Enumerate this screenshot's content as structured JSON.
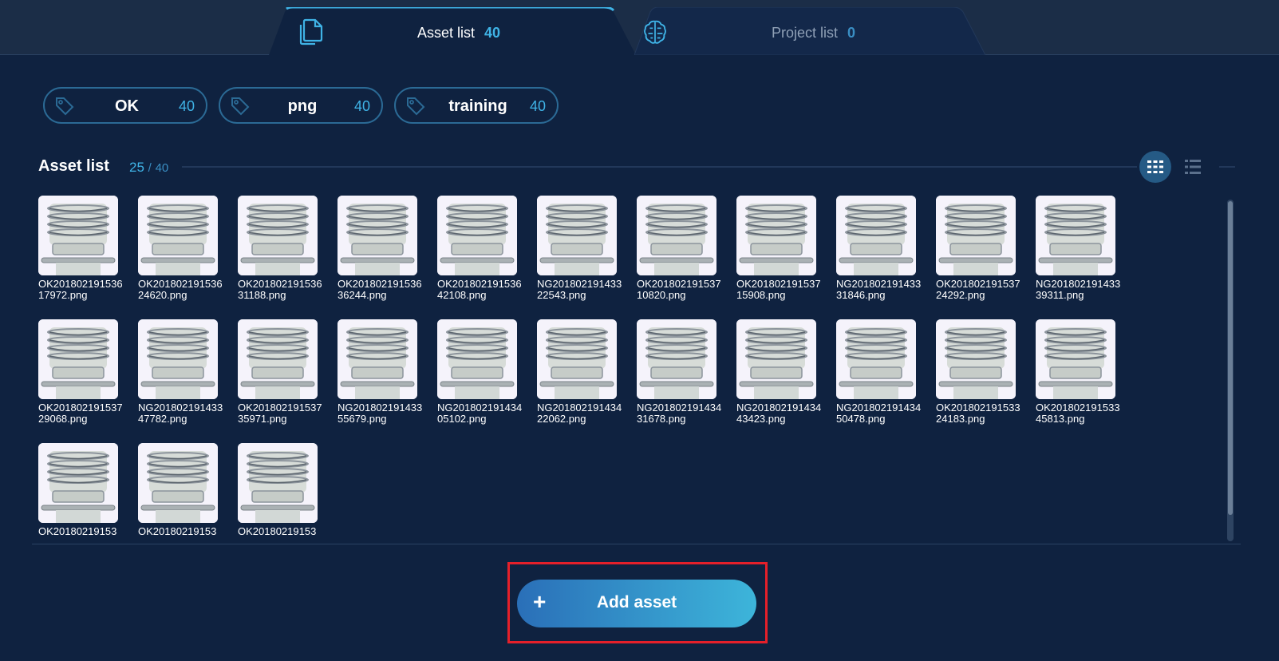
{
  "tabs": [
    {
      "label": "Asset list",
      "count": "40",
      "active": true,
      "icon": "documents-icon"
    },
    {
      "label": "Project list",
      "count": "0",
      "active": false,
      "icon": "brain-icon"
    }
  ],
  "tags": [
    {
      "label": "OK",
      "count": "40"
    },
    {
      "label": "png",
      "count": "40"
    },
    {
      "label": "training",
      "count": "40"
    }
  ],
  "asset_list": {
    "title": "Asset list",
    "shown": "25",
    "separator": "/",
    "total": "40"
  },
  "assets": [
    "OK20180219153617972.png",
    "OK20180219153624620.png",
    "OK20180219153631188.png",
    "OK20180219153636244.png",
    "OK20180219153642108.png",
    "NG20180219143322543.png",
    "OK20180219153710820.png",
    "OK20180219153715908.png",
    "NG20180219143331846.png",
    "OK20180219153724292.png",
    "NG20180219143339311.png",
    "OK20180219153729068.png",
    "NG20180219143347782.png",
    "OK20180219153735971.png",
    "NG20180219143355679.png",
    "NG20180219143405102.png",
    "NG20180219143422062.png",
    "NG20180219143431678.png",
    "NG20180219143443423.png",
    "NG20180219143450478.png",
    "OK20180219153324183.png",
    "OK20180219153345813.png",
    "OK20180219153",
    "OK20180219153",
    "OK20180219153"
  ],
  "add_button": {
    "plus": "+",
    "label": "Add asset"
  },
  "colors": {
    "background": "#0f2240",
    "accent": "#3fb3e6",
    "highlight": "#e5202a"
  }
}
